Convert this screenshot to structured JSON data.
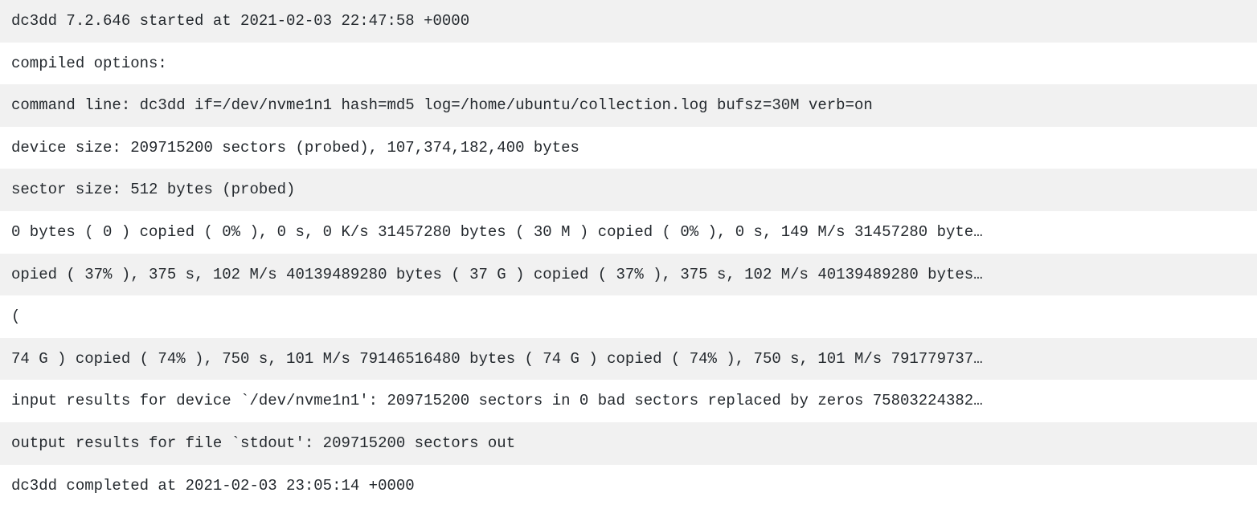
{
  "terminal": {
    "lines": [
      "dc3dd 7.2.646 started at 2021-02-03 22:47:58 +0000",
      "compiled options:",
      "command line: dc3dd if=/dev/nvme1n1 hash=md5 log=/home/ubuntu/collection.log bufsz=30M verb=on",
      "device size: 209715200 sectors (probed), 107,374,182,400 bytes",
      "sector size: 512 bytes (probed)",
      "0 bytes ( 0 ) copied ( 0% ), 0 s, 0 K/s 31457280 bytes ( 30 M ) copied ( 0% ), 0 s, 149 M/s 31457280 byte…",
      "opied ( 37% ), 375 s, 102 M/s 40139489280 bytes ( 37 G ) copied ( 37% ), 375 s, 102 M/s 40139489280 bytes…",
      "(",
      "74 G ) copied ( 74% ), 750 s, 101 M/s 79146516480 bytes ( 74 G ) copied ( 74% ), 750 s, 101 M/s 791779737…",
      "input results for device `/dev/nvme1n1': 209715200 sectors in 0 bad sectors replaced by zeros 75803224382…",
      "output results for file `stdout': 209715200 sectors out",
      "dc3dd completed at 2021-02-03 23:05:14 +0000"
    ]
  }
}
